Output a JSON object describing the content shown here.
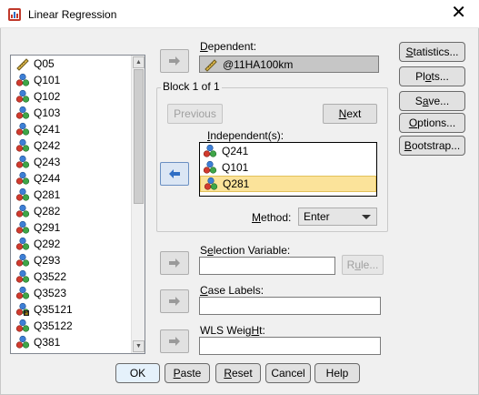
{
  "window": {
    "title": "Linear Regression",
    "close_glyph": "✕"
  },
  "variables": [
    {
      "name": "Q05",
      "icon": "scale-ruler-icon"
    },
    {
      "name": "Q101",
      "icon": "nominal-icon"
    },
    {
      "name": "Q102",
      "icon": "nominal-icon"
    },
    {
      "name": "Q103",
      "icon": "nominal-icon"
    },
    {
      "name": "Q241",
      "icon": "nominal-icon"
    },
    {
      "name": "Q242",
      "icon": "nominal-icon"
    },
    {
      "name": "Q243",
      "icon": "nominal-icon"
    },
    {
      "name": "Q244",
      "icon": "nominal-icon"
    },
    {
      "name": "Q281",
      "icon": "nominal-icon"
    },
    {
      "name": "Q282",
      "icon": "nominal-icon"
    },
    {
      "name": "Q291",
      "icon": "nominal-icon"
    },
    {
      "name": "Q292",
      "icon": "nominal-icon"
    },
    {
      "name": "Q293",
      "icon": "nominal-icon"
    },
    {
      "name": "Q3522",
      "icon": "nominal-icon"
    },
    {
      "name": "Q3523",
      "icon": "nominal-icon"
    },
    {
      "name": "Q35121",
      "icon": "string-nominal-icon"
    },
    {
      "name": "Q35122",
      "icon": "nominal-icon"
    },
    {
      "name": "Q381",
      "icon": "nominal-icon"
    }
  ],
  "dependent": {
    "label_u": "D",
    "label_rest": "ependent:",
    "value": "@11HA100km"
  },
  "block": {
    "title": "Block 1 of 1",
    "previous": "Previous",
    "next_u": "N",
    "next_rest": "ext",
    "independents_label_u": "I",
    "independents_label_rest": "ndependent(s):",
    "independents": [
      "Q241",
      "Q101",
      "Q281"
    ],
    "selected_independent": "Q281",
    "method_label_u": "M",
    "method_label_rest": "ethod:",
    "method_value": "Enter"
  },
  "selection": {
    "label_u": "e",
    "label_pre": "S",
    "label_rest": "lection Variable:",
    "rule_u": "u",
    "rule_pre": "R",
    "rule_rest": "le..."
  },
  "case_labels": {
    "label_u": "C",
    "label_rest": "ase Labels:"
  },
  "wls": {
    "label_u": "H",
    "label_pre": "WLS Weig",
    "label_rest": "t:"
  },
  "side_buttons": [
    {
      "u": "S",
      "rest": "tatistics..."
    },
    {
      "pre": "Pl",
      "u": "o",
      "rest": "ts..."
    },
    {
      "pre": "S",
      "u": "a",
      "rest": "ve..."
    },
    {
      "u": "O",
      "rest": "ptions..."
    },
    {
      "u": "B",
      "rest": "ootstrap..."
    }
  ],
  "bottom_buttons": {
    "ok": "OK",
    "paste_u": "P",
    "paste_rest": "aste",
    "reset_u": "R",
    "reset_rest": "eset",
    "cancel": "Cancel",
    "help": "Help"
  },
  "colors": {
    "accent_blue": "#3c7fb1",
    "selected_item": "#fbe39a",
    "arrow_blue": "#2f6ec4"
  }
}
